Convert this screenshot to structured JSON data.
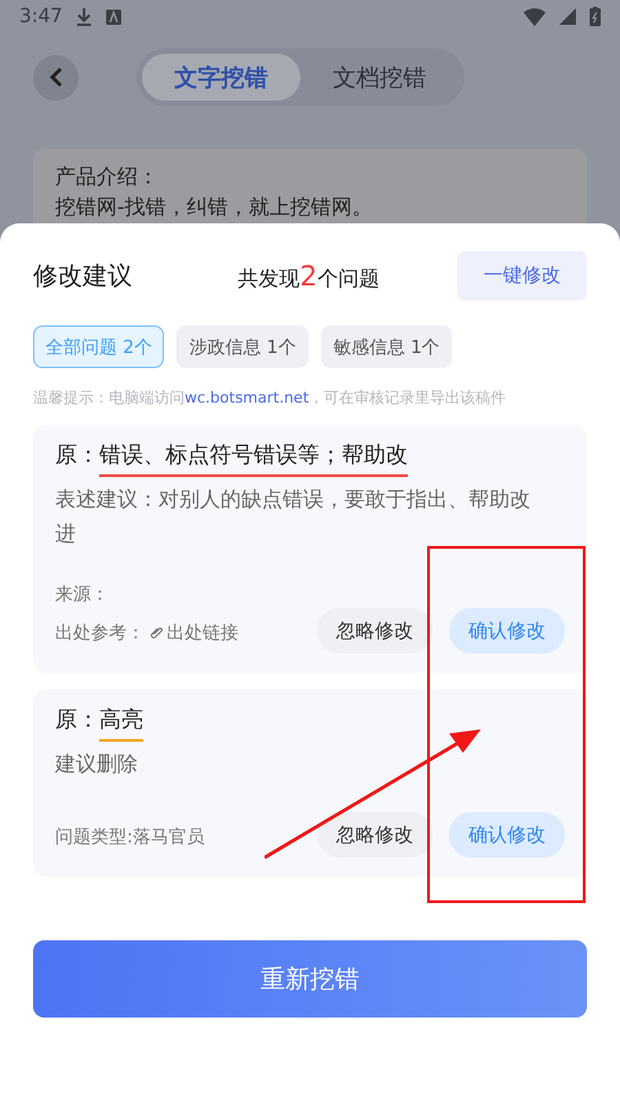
{
  "status_bar": {
    "time": "3:47"
  },
  "tabs": [
    {
      "label": "文字挖错",
      "selected": true
    },
    {
      "label": "文档挖错",
      "selected": false
    }
  ],
  "intro": {
    "title": "产品介绍：",
    "body": "挖错网-找错，纠错，就上挖错网。"
  },
  "sheet": {
    "title": "修改建议",
    "summary": {
      "prefix": "共发现",
      "count": "2",
      "suffix": "个问题"
    },
    "fix_all_button": "一键修改",
    "filters": [
      {
        "label": "全部问题 2个",
        "selected": true
      },
      {
        "label": "涉政信息 1个",
        "selected": false
      },
      {
        "label": "敏感信息 1个",
        "selected": false
      }
    ],
    "hint": {
      "prefix": "温馨提示：电脑端访问",
      "link": "wc.botsmart.net",
      "suffix": "，可在审核记录里导出该稿件"
    },
    "issues": [
      {
        "original_label": "原：",
        "original": "错误、标点符号错误等；帮助改",
        "color": "#f04a4a",
        "suggestion": "表述建议：对别人的缺点错误，要敢于指出、帮助改进",
        "meta": [
          {
            "text": "来源："
          },
          {
            "text": "出处参考：",
            "link": "出处链接"
          }
        ],
        "ignore_button": "忽略修改",
        "confirm_button": "确认修改"
      },
      {
        "original_label": "原：",
        "original": "高亮",
        "color": "#f5a623",
        "suggestion": "建议删除",
        "meta": [
          {
            "text": "问题类型:落马官员"
          }
        ],
        "ignore_button": "忽略修改",
        "confirm_button": "确认修改"
      }
    ],
    "rescan_button": "重新挖错"
  }
}
